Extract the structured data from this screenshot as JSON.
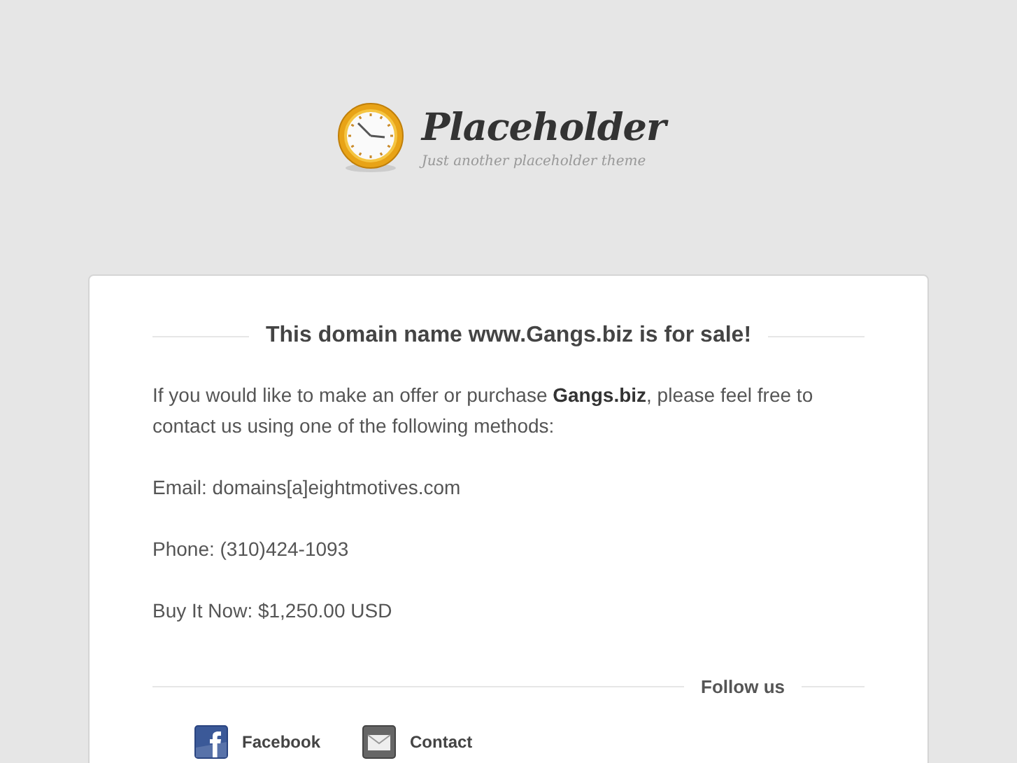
{
  "brand": {
    "name": "Placeholder",
    "tagline": "Just another placeholder theme"
  },
  "card": {
    "heading": "This domain name www.Gangs.biz is for sale!",
    "paragraphs": [
      "If you would like to make an offer or purchase **Gangs.biz**, please feel free to contact us using one of the following methods:",
      "Email: domains[a]eightmotives.com",
      "Phone: (310)424-1093",
      "Buy It Now: $1,250.00 USD"
    ],
    "follow_heading": "Follow us",
    "links": [
      {
        "kind": "facebook",
        "label": "Facebook"
      },
      {
        "kind": "mail",
        "label": "Contact"
      }
    ]
  }
}
